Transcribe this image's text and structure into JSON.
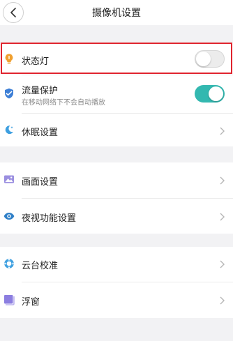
{
  "header": {
    "title": "摄像机设置"
  },
  "settings": {
    "status_light": {
      "label": "状态灯",
      "enabled": false
    },
    "traffic_protection": {
      "label": "流量保护",
      "subtitle": "在移动网络下不会自动播放",
      "enabled": true
    },
    "sleep": {
      "label": "休眠设置"
    },
    "picture": {
      "label": "画面设置"
    },
    "night_vision": {
      "label": "夜视功能设置"
    },
    "ptz_calibration": {
      "label": "云台校准"
    },
    "floating_window": {
      "label": "浮窗"
    }
  },
  "colors": {
    "accent": "#33b8b0",
    "highlight": "#e0242e",
    "bulb": "#f0a030",
    "shield": "#3d7fd6",
    "moon": "#3d9fe0",
    "picture": "#9b8fe0",
    "eye": "#2f80c8",
    "ptz": "#3d9fe0",
    "window": "#8c7ee0"
  },
  "icons": {
    "back": "back-arrow-icon",
    "status_light": "lightbulb-icon",
    "traffic_protection": "shield-icon",
    "sleep": "moon-icon",
    "picture": "picture-icon",
    "night_vision": "eye-icon",
    "ptz_calibration": "calibration-icon",
    "floating_window": "floating-window-icon",
    "chevron": "chevron-right-icon"
  }
}
